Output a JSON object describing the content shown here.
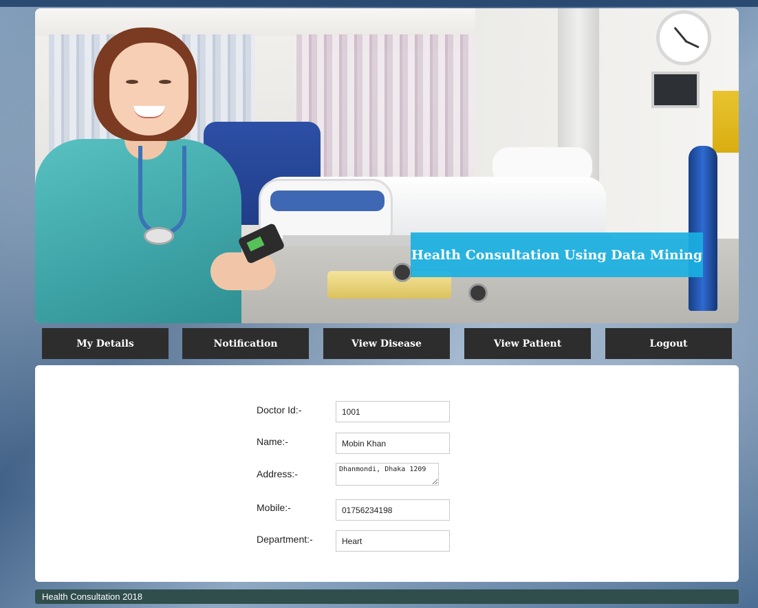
{
  "hero": {
    "title": "Health Consultation Using Data Mining"
  },
  "nav": [
    {
      "label": "My Details"
    },
    {
      "label": "Notification"
    },
    {
      "label": "View Disease"
    },
    {
      "label": "View Patient"
    },
    {
      "label": "Logout"
    }
  ],
  "form": {
    "doctor_id": {
      "label": "Doctor Id:-",
      "value": "1001"
    },
    "name": {
      "label": "Name:-",
      "value": "Mobin Khan"
    },
    "address": {
      "label": "Address:-",
      "value": "Dhanmondi, Dhaka 1209"
    },
    "mobile": {
      "label": "Mobile:-",
      "value": "01756234198"
    },
    "department": {
      "label": "Department:-",
      "value": "Heart"
    }
  },
  "footer": {
    "text": "Health Consultation 2018"
  },
  "colors": {
    "nav_bg": "#2d2d2d",
    "title_bg": "#1ab0e2",
    "footer_bg": "#2f4e4c"
  }
}
